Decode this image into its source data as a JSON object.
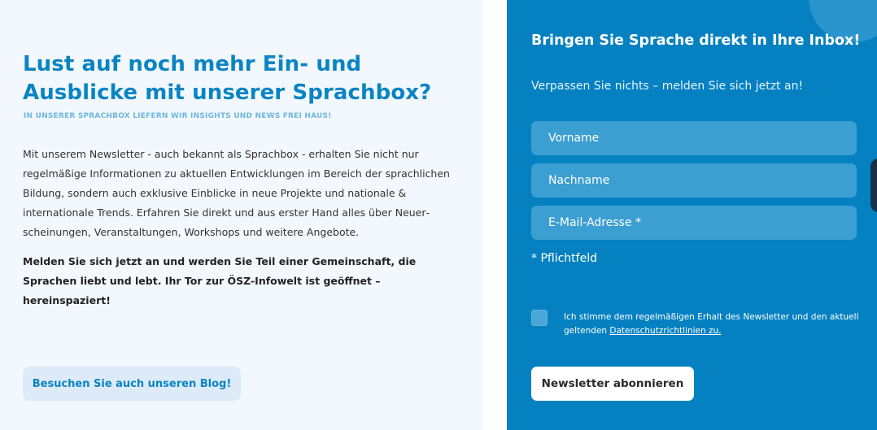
{
  "left": {
    "heading": "Lust auf noch mehr Ein- und Ausblicke mit unserer Sprachbox?",
    "subheading": "IN UNSERER SPRACHBOX LIEFERN WIR INSIGHTS UND NEWS FREI HAUS!",
    "paragraph": "Mit unserem Newsletter - auch bekannt als Sprachbox - erhalten Sie nicht nur regelmäßige Informationen zu aktuellen Entwicklungen im Bereich der sprachli­chen Bildung, sondern auch exklusive Einblicke in neue Projekte und nationale & internationale Trends. Erfahren Sie direkt und aus erster Hand alles über Neuer­scheinungen, Veranstaltungen, Workshops und weitere Angebote.",
    "paragraph_bold": "Melden Sie sich jetzt an und werden Sie Teil einer Gemeinschaft, die Sprachen liebt und lebt. Ihr Tor zur ÖSZ-Infowelt ist geöffnet – hereinspaziert!",
    "blog_button": "Besuchen Sie auch unseren Blog!"
  },
  "form": {
    "title": "Bringen Sie Sprache direkt in Ihre Inbox!",
    "subtitle": "Verpassen Sie nichts – melden Sie sich jetzt an!",
    "first_name_placeholder": "Vorname",
    "last_name_placeholder": "Nachname",
    "email_placeholder": "E-Mail-Adresse *",
    "required_note": "* Pflichtfeld",
    "consent_text": "Ich stimme dem regelmäßigen Erhalt des Newsletter und den aktuell geltenden ",
    "consent_link": "Datenschutzrichtlinien zu.",
    "consent_checked": false,
    "subscribe_button": "Newsletter abonnieren"
  },
  "colors": {
    "brand_blue": "#0581c2",
    "heading_blue": "#0a84c4",
    "subheading_blue": "#6eb6de",
    "left_background": "#f2f8fd",
    "field_background": "#3c9fd2"
  }
}
